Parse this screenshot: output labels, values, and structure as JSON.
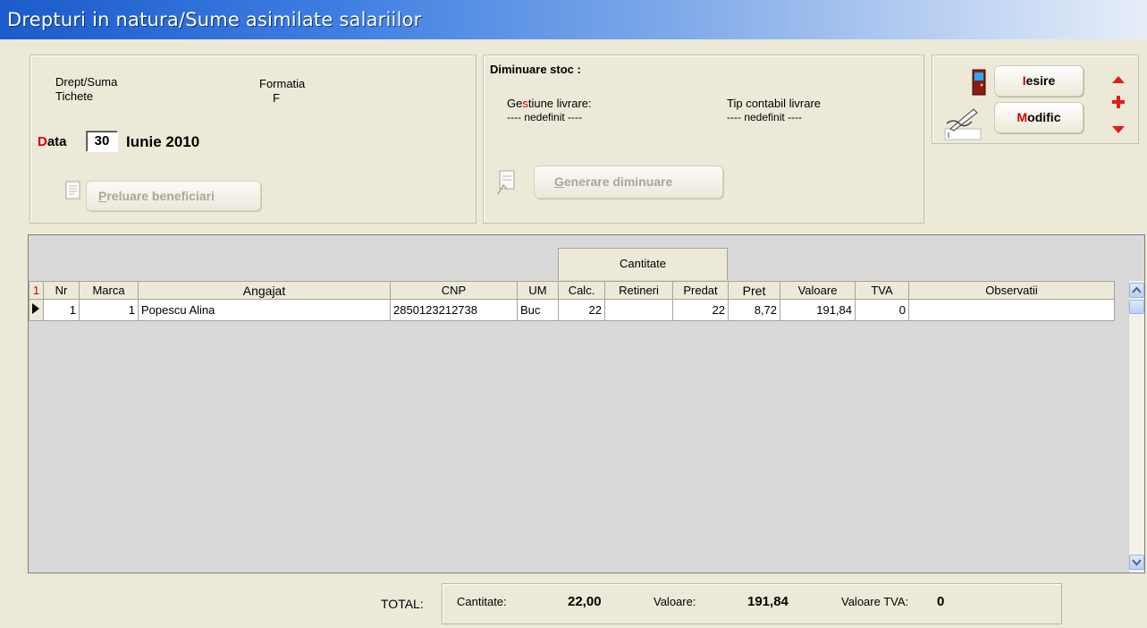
{
  "window": {
    "title": "Drepturi in natura/Sume asimilate salariilor"
  },
  "info": {
    "drept_label": "Drept/Suma",
    "drept_value": "Tichete",
    "formatia_label": "Formatia",
    "formatia_value": "F",
    "data_label_first": "D",
    "data_label_rest": "ata",
    "data_day": "30",
    "data_month_year": "Iunie 2010",
    "preluare_first": "P",
    "preluare_rest": "reluare beneficiari"
  },
  "stoc": {
    "header": "Diminuare stoc :",
    "gestiune_pre": "Ge",
    "gestiune_hot": "s",
    "gestiune_post": "tiune livrare:",
    "gestiune_value": "---- nedefinit ----",
    "tip_label": "Tip contabil livrare",
    "tip_value": "---- nedefinit ----",
    "generare_first": "G",
    "generare_rest": "enerare diminuare"
  },
  "actions": {
    "iesire_first": "I",
    "iesire_rest": "esire",
    "modific_first": "M",
    "modific_rest": "odific"
  },
  "grid": {
    "group_header": "Cantitate",
    "row_indicator": "1",
    "columns": [
      "Nr",
      "Marca",
      "Angajat",
      "CNP",
      "UM",
      "Calc.",
      "Retineri",
      "Predat",
      "Pret",
      "Valoare",
      "TVA",
      "Observatii"
    ],
    "rows": [
      {
        "nr": "1",
        "marca": "1",
        "angajat": "Popescu Alina",
        "cnp": "2850123212738",
        "um": "Buc",
        "calc": "22",
        "retineri": "",
        "predat": "22",
        "pret": "8,72",
        "valoare": "191,84",
        "tva": "0",
        "observatii": ""
      }
    ]
  },
  "totals": {
    "label": "TOTAL:",
    "cantitate_label": "Cantitate:",
    "cantitate_value": "22,00",
    "valoare_label": "Valoare:",
    "valoare_value": "191,84",
    "tva_label": "Valoare TVA:",
    "tva_value": "0"
  },
  "colors": {
    "accent_red": "#d40000",
    "title_blue": "#1b5bcb",
    "background": "#ece9d8"
  }
}
